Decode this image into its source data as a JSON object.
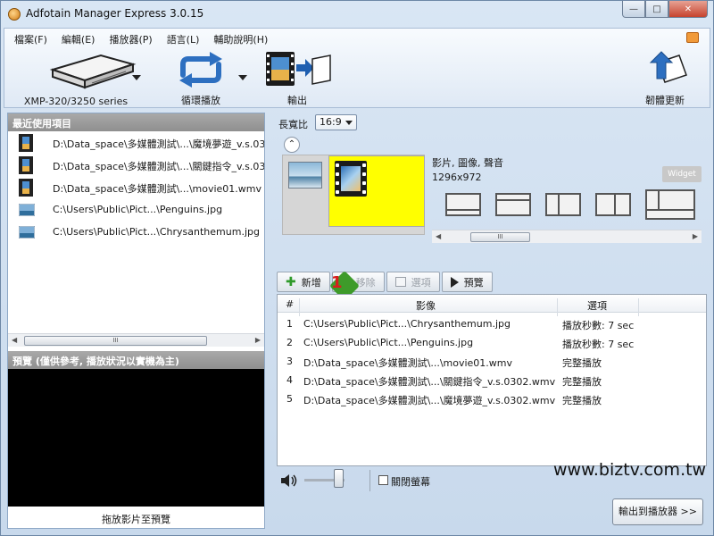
{
  "window": {
    "title": "Adfotain Manager Express 3.0.15"
  },
  "menu": [
    "檔案(F)",
    "編輯(E)",
    "播放器(P)",
    "語言(L)",
    "輔助說明(H)"
  ],
  "toolbar": {
    "player_label": "XMP-320/3250 series",
    "loop_label": "循環播放",
    "output_label": "輸出",
    "update_label": "韌體更新"
  },
  "recent": {
    "header": "最近使用項目",
    "items": [
      {
        "icon": "film-icon",
        "text": "D:\\Data_space\\多媒體測試\\...\\魔境夢遊_v.s.03"
      },
      {
        "icon": "film-icon",
        "text": "D:\\Data_space\\多媒體測試\\...\\關鍵指令_v.s.03"
      },
      {
        "icon": "film-icon",
        "text": "D:\\Data_space\\多媒體測試\\...\\movie01.wmv"
      },
      {
        "icon": "image-icon",
        "text": "C:\\Users\\Public\\Pict...\\Penguins.jpg"
      },
      {
        "icon": "image-icon",
        "text": "C:\\Users\\Public\\Pict...\\Chrysanthemum.jpg"
      }
    ],
    "scroll_glyph": "III"
  },
  "preview": {
    "header": "預覽 (僅供參考, 播放狀況以實機為主)",
    "drop_hint": "拖放影片至預覽"
  },
  "layout": {
    "aspect_label": "長寬比",
    "aspect_value": "16:9",
    "zone_type": "影片, 圖像, 聲音",
    "zone_size": "1296x972",
    "widget_label": "Widget",
    "scroll_glyph": "III"
  },
  "actions": {
    "add": "新增",
    "remove": "移除",
    "options": "選項",
    "preview": "預覽",
    "badge_number": "1"
  },
  "playlist": {
    "columns": [
      "#",
      "影像",
      "選項"
    ],
    "rows": [
      {
        "num": "1",
        "path": "C:\\Users\\Public\\Pict...\\Chrysanthemum.jpg",
        "option": "播放秒數: 7 sec"
      },
      {
        "num": "2",
        "path": "C:\\Users\\Public\\Pict...\\Penguins.jpg",
        "option": "播放秒數: 7 sec"
      },
      {
        "num": "3",
        "path": "D:\\Data_space\\多媒體測試\\...\\movie01.wmv",
        "option": "完整播放"
      },
      {
        "num": "4",
        "path": "D:\\Data_space\\多媒體測試\\...\\關鍵指令_v.s.0302.wmv",
        "option": "完整播放"
      },
      {
        "num": "5",
        "path": "D:\\Data_space\\多媒體測試\\...\\魔境夢遊_v.s.0302.wmv",
        "option": "完整播放"
      }
    ]
  },
  "bottom": {
    "mute_label": "關閉螢幕",
    "watermark": "www.biztv.com.tw",
    "output_button": "輸出到播放器 >>"
  }
}
